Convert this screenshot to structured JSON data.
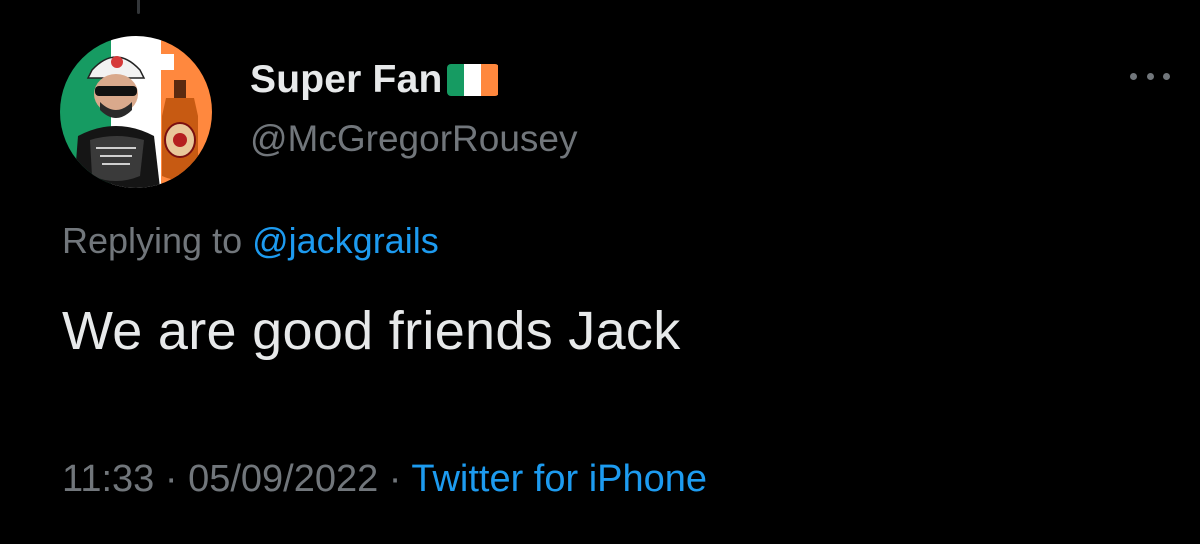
{
  "colors": {
    "background": "#000000",
    "primary_text": "#e7e9ea",
    "secondary_text": "#71767b",
    "link": "#1d9bf0"
  },
  "author": {
    "display_name": "Super Fan",
    "flag_icon": "ireland-flag-icon",
    "handle": "@McGregorRousey",
    "avatar_icon": "profile-avatar",
    "avatar_badge_text": "SUPER FAN",
    "avatar_shirt_text": "TAPOUT",
    "avatar_bottle_text": "FOWLER'S HEAD"
  },
  "reply": {
    "prefix": "Replying to ",
    "mention": "@jackgrails"
  },
  "tweet": {
    "text": "We are good friends Jack"
  },
  "meta": {
    "time": "11:33",
    "separator_1": " · ",
    "date": "05/09/2022",
    "separator_2": " · ",
    "source": "Twitter for iPhone"
  },
  "more_menu": {
    "icon": "more-horizontal-icon"
  }
}
